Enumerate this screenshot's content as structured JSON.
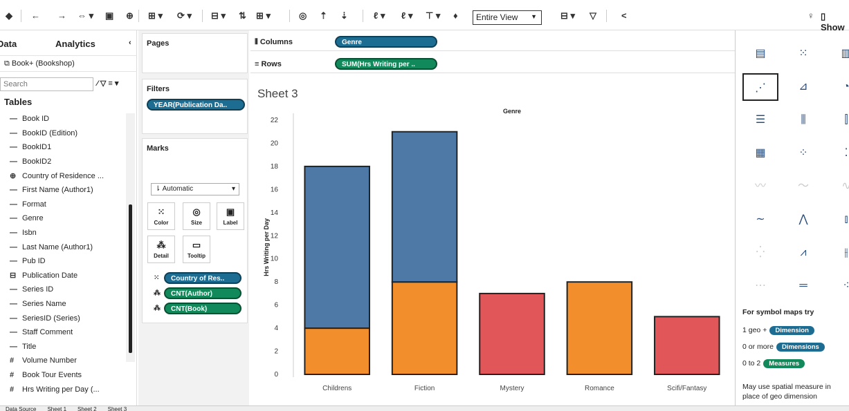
{
  "toolbar": {
    "icons": [
      "tableau-icon",
      "undo-icon",
      "redo-icon",
      "save-icon",
      "new-datasource-icon",
      "new-worksheet-icon",
      "duplicate-icon",
      "clear-icon",
      "swap-icon",
      "sort-ascending-icon",
      "sort-descending-icon",
      "highlight-icon",
      "group-icon",
      "label-icon",
      "fix-axes-icon",
      "pin-icon",
      "fit-icon",
      "show-cards-icon",
      "tooltip-icon",
      "share-icon"
    ],
    "fit_value": "Entire View",
    "show_me_label": "Show Me"
  },
  "data_pane": {
    "tabs": [
      "Data",
      "Analytics"
    ],
    "datasource": "Book+ (Bookshop)",
    "search_placeholder": "Search",
    "tables_heading": "Tables",
    "fields": [
      {
        "icon": "—",
        "name": "Book ID"
      },
      {
        "icon": "—",
        "name": "BookID (Edition)"
      },
      {
        "icon": "—",
        "name": "BookID1"
      },
      {
        "icon": "—",
        "name": "BookID2"
      },
      {
        "icon": "⊕",
        "name": "Country of Residence ..."
      },
      {
        "icon": "—",
        "name": "First Name (Author1)"
      },
      {
        "icon": "—",
        "name": "Format"
      },
      {
        "icon": "—",
        "name": "Genre"
      },
      {
        "icon": "—",
        "name": "Isbn"
      },
      {
        "icon": "—",
        "name": "Last Name (Author1)"
      },
      {
        "icon": "—",
        "name": "Pub ID"
      },
      {
        "icon": "⊟",
        "name": "Publication Date"
      },
      {
        "icon": "—",
        "name": "Series ID"
      },
      {
        "icon": "—",
        "name": "Series Name"
      },
      {
        "icon": "—",
        "name": "SeriesID (Series)"
      },
      {
        "icon": "—",
        "name": "Staff Comment"
      },
      {
        "icon": "—",
        "name": "Title"
      },
      {
        "icon": "#",
        "name": "Volume Number"
      },
      {
        "icon": "#",
        "name": "Book Tour Events"
      },
      {
        "icon": "#",
        "name": "Hrs Writing per Day (..."
      }
    ]
  },
  "cards": {
    "pages_title": "Pages",
    "filters_title": "Filters",
    "filter_pill": "YEAR(Publication Da..",
    "marks_title": "Marks",
    "marks_type": "Automatic",
    "mark_buttons": [
      "Color",
      "Size",
      "Label",
      "Detail",
      "Tooltip"
    ],
    "mark_pills": [
      "Country of Res..",
      "CNT(Author)",
      "CNT(Book)"
    ]
  },
  "shelves": {
    "columns_label": "Columns",
    "columns_pill": "Genre",
    "rows_label": "Rows",
    "rows_pill": "SUM(Hrs Writing per .."
  },
  "view": {
    "sheet_title": "Sheet 3"
  },
  "chart_data": {
    "type": "bar",
    "title": "Genre",
    "xlabel": "",
    "ylabel": "Hrs Writing per Day",
    "ylim": [
      0,
      22
    ],
    "yticks": [
      0,
      2,
      4,
      6,
      8,
      10,
      12,
      14,
      16,
      18,
      20,
      22
    ],
    "categories": [
      "Childrens",
      "Fiction",
      "Mystery",
      "Romance",
      "Scifi/Fantasy"
    ],
    "series": [
      {
        "name": "",
        "color": "#f28e2b",
        "values": [
          4,
          8,
          0,
          8,
          0
        ]
      },
      {
        "name": "",
        "color": "#e15759",
        "values": [
          0,
          0,
          7,
          0,
          5
        ]
      },
      {
        "name": "",
        "color": "#4e79a7",
        "values": [
          14,
          13,
          0,
          0,
          0
        ]
      }
    ],
    "stacked": true,
    "grid": false
  },
  "show_me": {
    "symbol_heading": "For symbol maps try",
    "rows": [
      {
        "prefix": "1 geo +",
        "pill": "Dimension",
        "color": "#1d6d93"
      },
      {
        "prefix": "0 or more",
        "pill": "Dimensions",
        "color": "#1d6d93"
      },
      {
        "prefix": "0 to 2",
        "pill": "Measures",
        "color": "#11895a"
      }
    ],
    "note_line1": "May use spatial measure in",
    "note_line2": "place of geo dimension"
  },
  "sheet_tabs": [
    "Data Source",
    "Sheet 1",
    "Sheet 2",
    "Sheet 3"
  ]
}
